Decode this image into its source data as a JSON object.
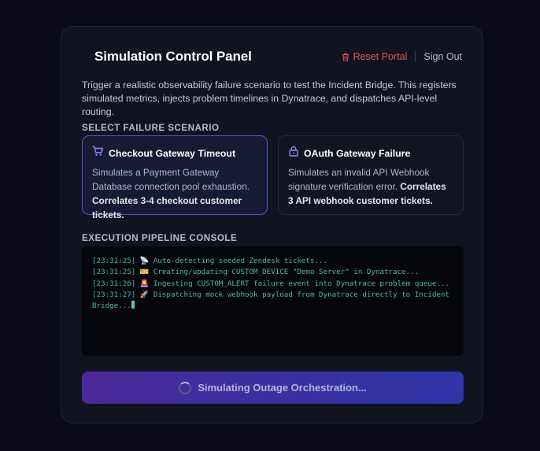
{
  "header": {
    "title": "Simulation Control Panel",
    "reset_label": "Reset Portal",
    "signout_label": "Sign Out"
  },
  "description": "Trigger a realistic observability failure scenario to test the Incident Bridge. This registers simulated metrics, injects problem timelines in Dynatrace, and dispatches API-level routing.",
  "scenarios": {
    "label": "SELECT FAILURE SCENARIO",
    "items": [
      {
        "title": "Checkout Gateway Timeout",
        "icon": "cart-icon",
        "body": "Simulates a Payment Gateway Database connection pool exhaustion.",
        "emphasis": "Correlates 3-4 checkout customer tickets.",
        "selected": true
      },
      {
        "title": "OAuth Gateway Failure",
        "icon": "lock-icon",
        "body": "Simulates an invalid API Webhook signature verification error.",
        "emphasis": "Correlates 3 API webhook customer tickets.",
        "selected": false
      }
    ]
  },
  "console": {
    "label": "EXECUTION PIPELINE CONSOLE",
    "lines": [
      "[23:31:25] 📡 Auto-detecting seeded Zendesk tickets...",
      "[23:31:25] 🎫 Creating/updating CUSTOM_DEVICE \"Demo Server\" in Dynatrace...",
      "[23:31:26] 🚨 Ingesting CUSTOM_ALERT failure event into Dynatrace problem queue...",
      "[23:31:27] 🚀 Dispatching mock webhook payload from Dynatrace directly to Incident Bridge..."
    ]
  },
  "action": {
    "label": "Simulating Outage Orchestration...",
    "icon": "spinner-icon"
  },
  "colors": {
    "accent": "#5c55c7",
    "danger": "#d1595e",
    "console_text": "#4fb99a"
  }
}
